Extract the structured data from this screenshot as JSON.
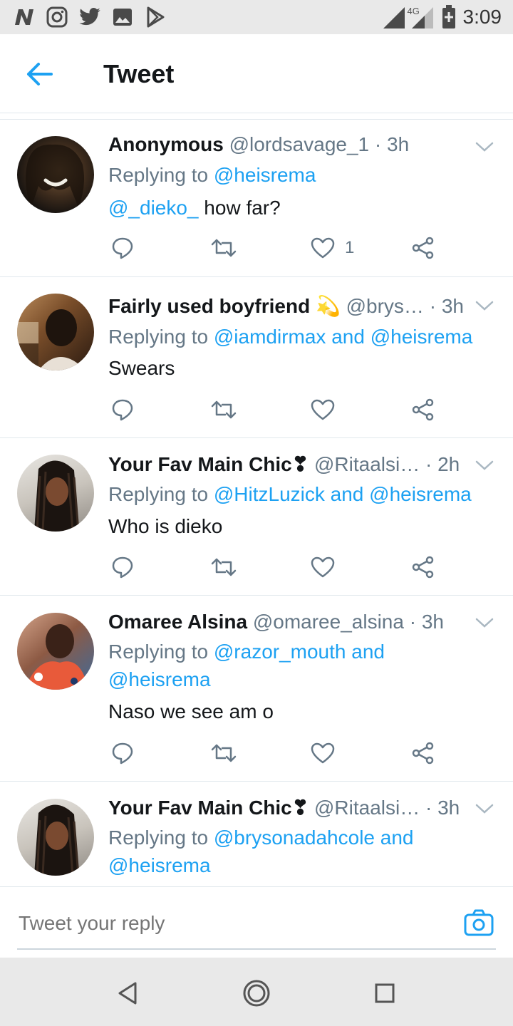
{
  "status_bar": {
    "time": "3:09",
    "network": "4G",
    "left_icons": [
      "n-app-icon",
      "instagram-icon",
      "twitter-icon",
      "image-icon",
      "play-store-icon"
    ],
    "right_icons": [
      "signal-icon",
      "signal-4g-icon",
      "battery-icon"
    ]
  },
  "header": {
    "title": "Tweet"
  },
  "tweets": [
    {
      "name": "Anonymous",
      "handle": "@lordsavage_1",
      "time": "· 3h",
      "replying_prefix": "Replying to ",
      "replying_to": "@heisrema",
      "text_mention": "@_dieko_",
      "text": " how far?",
      "like_count": "1"
    },
    {
      "name": "Fairly used boyfriend 💫",
      "handle": "@brys…",
      "time": "· 3h",
      "replying_prefix": "Replying to ",
      "replying_to": "@iamdirmax and @heisrema",
      "text": "Swears"
    },
    {
      "name": "Your Fav Main Chic❣",
      "handle": "@Ritaalsi…",
      "time": "· 2h",
      "replying_prefix": "Replying to ",
      "replying_to": "@HitzLuzick and @heisrema",
      "text": "Who is dieko"
    },
    {
      "name": "Omaree Alsina",
      "handle": "@omaree_alsina",
      "time": "· 3h",
      "replying_prefix": "Replying to ",
      "replying_to": "@razor_mouth and",
      "replying_to_line2": "@heisrema",
      "text": "Naso we see am o"
    },
    {
      "name": "Your Fav Main Chic❣",
      "handle": "@Ritaalsi…",
      "time": "· 3h",
      "replying_prefix": "Replying to ",
      "replying_to": "@brysonadahcole and",
      "replying_to_line2": "@heisrema"
    }
  ],
  "reply_bar": {
    "placeholder": "Tweet your reply"
  },
  "colors": {
    "accent": "#1da1f2",
    "secondary_text": "#657786",
    "primary_text": "#14171a",
    "divider": "#e1e8ed",
    "system_bar": "#e9e9e9"
  },
  "nav_bar": {
    "buttons": [
      "back-triangle-icon",
      "home-circle-icon",
      "recents-square-icon"
    ]
  }
}
